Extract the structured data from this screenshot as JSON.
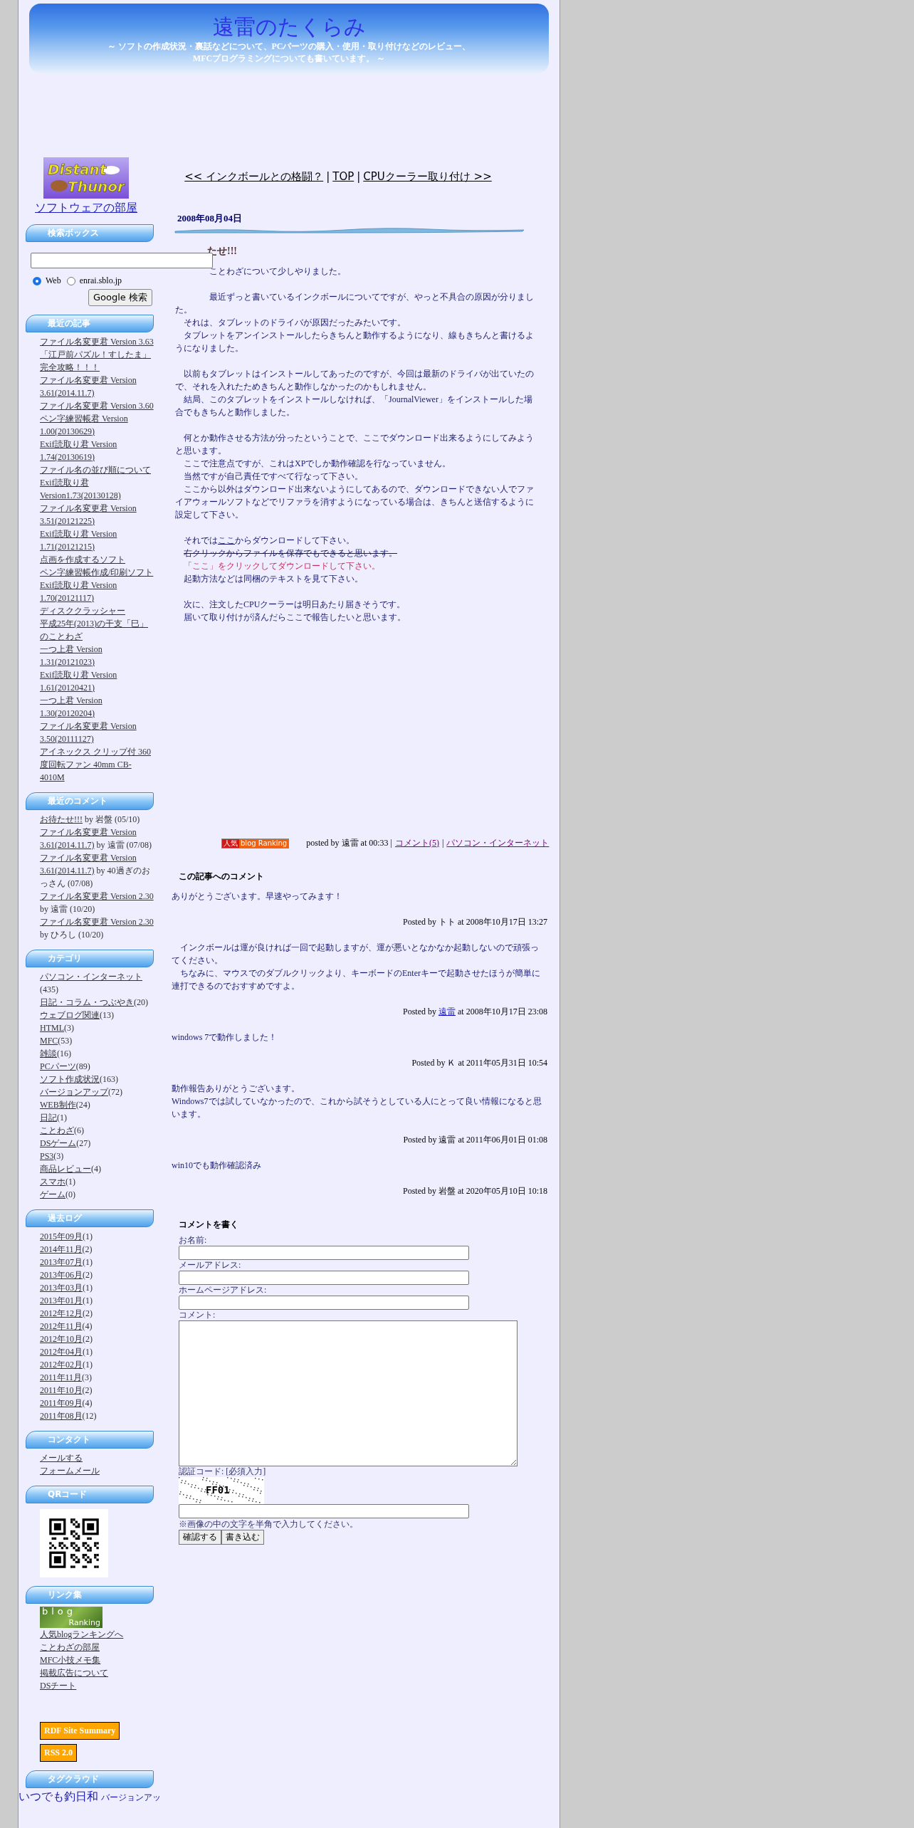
{
  "header": {
    "title": "遠雷のたくらみ",
    "subtitle_lines": [
      "～ ソフトの作成状況・裏話などについて、PCパーツの購入・使用・取り付けなどのレビュー、",
      "MFCプログラミングについても書いています。 ～"
    ]
  },
  "sidebar": {
    "logo": {
      "text_lines": [
        "Distant",
        "Thunor"
      ],
      "link": "ソフトウェアの部屋"
    },
    "search": {
      "title": "検索ボックス",
      "options": [
        {
          "label": "Web",
          "selected": true
        },
        {
          "label": "enrai.sblo.jp",
          "selected": false
        }
      ],
      "button": "Google 検索"
    },
    "recent_posts": {
      "title": "最近の記事",
      "items": [
        "ファイル名変更君 Version 3.63",
        "「江戸前パズル！すしたま」完全攻略！！！",
        "ファイル名変更君 Version 3.61(2014.11.7)",
        "ファイル名変更君 Version 3.60",
        "ペン字練習帳君 Version 1.00(20130629)",
        "Exif読取り君 Version 1.74(20130619)",
        "ファイル名の並び順について",
        "Exif読取り君 Version1.73(20130128)",
        "ファイル名変更君 Version 3.51(20121225)",
        "Exif読取り君 Version 1.71(20121215)",
        "点画を作成するソフト",
        "ペン字練習帳作成/印刷ソフト",
        "Exif読取り君 Version 1.70(20121117)",
        "ディスククラッシャー",
        "平成25年(2013)の干支「巳」のことわざ",
        "一つ上君 Version 1.31(20121023)",
        "Exif読取り君 Version 1.61(20120421)",
        "一つ上君 Version 1.30(20120204)",
        "ファイル名変更君 Version 3.50(20111127)",
        "アイネックス クリップ付 360度回転ファン 40mm CB-4010M"
      ]
    },
    "recent_comments": {
      "title": "最近のコメント",
      "items": [
        {
          "link": "お待たせ!!!",
          "text": "by 岩盤 (05/10)"
        },
        {
          "link": "ファイル名変更君 Version 3.61(2014.11.7)",
          "text": "by 遠雷 (07/08)"
        },
        {
          "link": "ファイル名変更君 Version 3.61(2014.11.7)",
          "text": "by 40過ぎのおっさん (07/08)"
        },
        {
          "link": "ファイル名変更君 Version 2.30",
          "text": "by 遠雷 (10/20)"
        },
        {
          "link": "ファイル名変更君 Version 2.30",
          "text": "by ひろし (10/20)"
        }
      ]
    },
    "categories": {
      "title": "カテゴリ",
      "items": [
        {
          "name": "パソコン・インターネット",
          "count": "(435)"
        },
        {
          "name": "日記・コラム・つぶやき",
          "count": "(20)"
        },
        {
          "name": "ウェブログ関連",
          "count": "(13)"
        },
        {
          "name": "HTML",
          "count": "(3)"
        },
        {
          "name": "MFC",
          "count": "(53)"
        },
        {
          "name": "雑談",
          "count": "(16)"
        },
        {
          "name": "PCパーツ",
          "count": "(89)"
        },
        {
          "name": "ソフト作成状況",
          "count": "(163)"
        },
        {
          "name": "バージョンアップ",
          "count": "(72)"
        },
        {
          "name": "WEB制作",
          "count": "(24)"
        },
        {
          "name": "日記",
          "count": "(1)"
        },
        {
          "name": "ことわざ",
          "count": "(6)"
        },
        {
          "name": "DSゲーム",
          "count": "(27)"
        },
        {
          "name": "PS3",
          "count": "(3)"
        },
        {
          "name": "商品レビュー",
          "count": "(4)"
        },
        {
          "name": "スマホ",
          "count": "(1)"
        },
        {
          "name": "ゲーム",
          "count": "(0)"
        }
      ]
    },
    "archives": {
      "title": "過去ログ",
      "items": [
        {
          "name": "2015年09月",
          "count": "(1)"
        },
        {
          "name": "2014年11月",
          "count": "(2)"
        },
        {
          "name": "2013年07月",
          "count": "(1)"
        },
        {
          "name": "2013年06月",
          "count": "(2)"
        },
        {
          "name": "2013年03月",
          "count": "(1)"
        },
        {
          "name": "2013年01月",
          "count": "(1)"
        },
        {
          "name": "2012年12月",
          "count": "(2)"
        },
        {
          "name": "2012年11月",
          "count": "(4)"
        },
        {
          "name": "2012年10月",
          "count": "(2)"
        },
        {
          "name": "2012年04月",
          "count": "(1)"
        },
        {
          "name": "2012年02月",
          "count": "(1)"
        },
        {
          "name": "2011年11月",
          "count": "(3)"
        },
        {
          "name": "2011年10月",
          "count": "(2)"
        },
        {
          "name": "2011年09月",
          "count": "(4)"
        },
        {
          "name": "2011年08月",
          "count": "(12)"
        }
      ]
    },
    "contact": {
      "title": "コンタクト",
      "items": [
        "メールする",
        "フォームメール"
      ]
    },
    "qr": {
      "title": "QRコード"
    },
    "links": {
      "title": "リンク集",
      "banner_lines": [
        "blog",
        "Ranking"
      ],
      "items": [
        "人気blogランキングへ",
        "ことわざの部屋",
        "MFC小技メモ集",
        "掲載広告について",
        "DSチート"
      ]
    },
    "feeds": [
      "RDF Site Summary",
      "RSS 2.0"
    ],
    "tag_cloud": {
      "title": "タグクラウド",
      "tags": [
        {
          "text": "いつでも釣日和",
          "kind": "large"
        },
        {
          "text": "バージョンアッ",
          "kind": "small"
        }
      ]
    }
  },
  "main": {
    "nav": {
      "prev": "<< インクボールとの格闘？",
      "sep1": "|",
      "top": "TOP",
      "sep2": "|",
      "next": "CPUクーラー取り付け >>"
    },
    "date": "2008年08月04日",
    "title": "たせ!!!",
    "body": [
      [
        {
          "kind": "lead",
          "text": "ことわざについて少しやりました。"
        }
      ],
      [
        {
          "kind": "lead",
          "text": "最近ずっと書いているインクボールについてですが、やっと不具合の原因が分りました。"
        },
        {
          "kind": "normal",
          "text": "それは、タブレットのドライバが原因だったみたいです。"
        },
        {
          "kind": "normal",
          "text": "タブレットをアンインストールしたらきちんと動作するようになり、線もきちんと書けるようになりました。"
        }
      ],
      [
        {
          "kind": "normal",
          "text": "以前もタブレットはインストールしてあったのですが、今回は最新のドライバが出ていたので、それを入れたためきちんと動作しなかったのかもしれません。"
        },
        {
          "kind": "normal",
          "text": "結局、このタブレットをインストールしなければ、「JournalViewer」をインストールした場合でもきちんと動作しました。"
        }
      ],
      [
        {
          "kind": "normal",
          "text": "何とか動作させる方法が分ったということで、ここでダウンロード出来るようにしてみようと思います。"
        },
        {
          "kind": "normal",
          "text": "ここで注意点ですが、これはXPでしか動作確認を行なっていません。"
        },
        {
          "kind": "normal",
          "text": "当然ですが自己責任ですべて行なって下さい。"
        },
        {
          "kind": "normal",
          "text": "ここから以外はダウンロード出来ないようにしてあるので、ダウンロードできない人でファイアウォールソフトなどでリファラを消すようになっている場合は、きちんと送信するように設定して下さい。"
        }
      ],
      [
        {
          "kind": "link",
          "before": "それでは",
          "link": "ここ",
          "after": "からダウンロードして下さい。"
        },
        {
          "kind": "strike",
          "text": "右クリックからファイルを保存でもできると思います。"
        },
        {
          "kind": "red",
          "text": "「ここ」をクリックしてダウンロードして下さい。"
        },
        {
          "kind": "normal",
          "text": "起動方法などは同梱のテキストを見て下さい。"
        }
      ],
      [
        {
          "kind": "normal",
          "text": "次に、注文したCPUクーラーは明日あたり届きそうです。"
        },
        {
          "kind": "normal",
          "text": "届いて取り付けが済んだらここで報告したいと思います。"
        }
      ]
    ],
    "footer": {
      "badge": [
        "人気",
        "blog Ranking"
      ],
      "posted": "posted by 遠雷 at 00:33 |",
      "comments_link": "コメント(5)",
      "sep": "|",
      "category_link": "パソコン・インターネット"
    },
    "comments": {
      "title": "この記事へのコメント",
      "items": [
        {
          "lines": [
            "ありがとうございます。早速やってみます！"
          ],
          "by": "Posted by",
          "author": "トト",
          "linked": false,
          "at": "at 2008年10月17日 13:27"
        },
        {
          "lines": [
            "　インクボールは運が良ければ一回で起動しますが、運が悪いとなかなか起動しないので頑張ってください。",
            "　ちなみに、マウスでのダブルクリックより、キーボードのEnterキーで起動させたほうが簡単に連打できるのでおすすめですよ。"
          ],
          "by": "Posted by",
          "author": "遠雷",
          "linked": true,
          "at": "at 2008年10月17日 23:08"
        },
        {
          "lines": [
            "windows 7で動作しました！"
          ],
          "by": "Posted by",
          "author": "Ｋ",
          "linked": false,
          "at": "at 2011年05月31日 10:54"
        },
        {
          "lines": [
            "動作報告ありがとうございます。",
            "Windows7では試していなかったので、これから試そうとしている人にとって良い情報になると思います。"
          ],
          "by": "Posted by",
          "author": "遠雷",
          "linked": false,
          "at": "at 2011年06月01日 01:08"
        },
        {
          "lines": [
            "win10でも動作確認済み"
          ],
          "by": "Posted by",
          "author": "岩盤",
          "linked": false,
          "at": "at 2020年05月10日 10:18"
        }
      ]
    },
    "form": {
      "title": "コメントを書く",
      "fields": [
        {
          "label": "お名前:",
          "kind": "input"
        },
        {
          "label": "メールアドレス:",
          "kind": "input"
        },
        {
          "label": "ホームページアドレス:",
          "kind": "input"
        },
        {
          "label": "コメント:",
          "kind": "textarea"
        },
        {
          "label": "認証コード: [必須入力]",
          "kind": "captcha",
          "code": "FF01"
        }
      ],
      "note": "※画像の中の文字を半角で入力してください。",
      "buttons": [
        "確認する",
        "書き込む"
      ]
    }
  }
}
